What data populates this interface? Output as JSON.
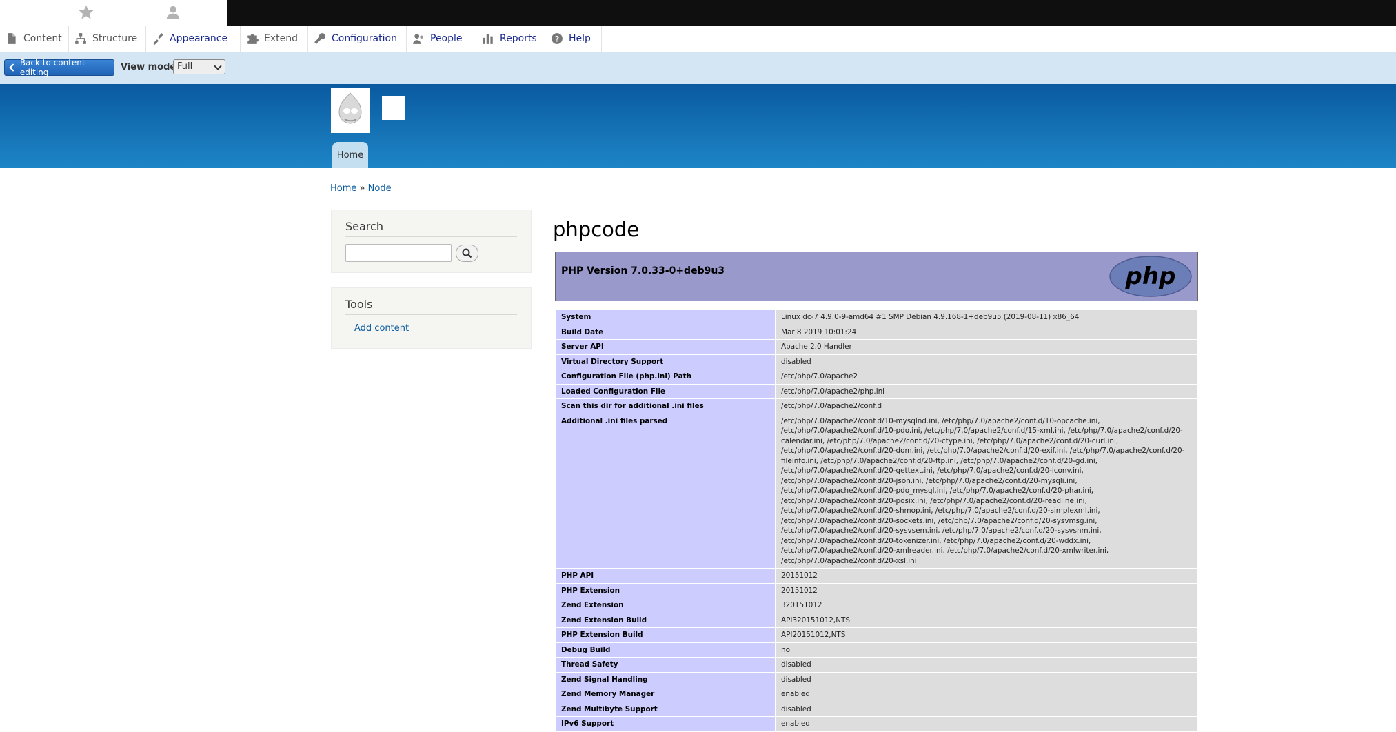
{
  "toolbar": {
    "icons": [
      "star-icon",
      "user-icon"
    ]
  },
  "admin_menu": {
    "items": [
      {
        "label": "Content",
        "icon": "file-icon"
      },
      {
        "label": "Structure",
        "icon": "sitemap-icon"
      },
      {
        "label": "Appearance",
        "icon": "paintbrush-icon"
      },
      {
        "label": "Extend",
        "icon": "puzzle-icon"
      },
      {
        "label": "Configuration",
        "icon": "wrench-icon"
      },
      {
        "label": "People",
        "icon": "people-icon"
      },
      {
        "label": "Reports",
        "icon": "bar-chart-icon"
      },
      {
        "label": "Help",
        "icon": "help-icon"
      }
    ]
  },
  "preview": {
    "back_label": "Back to content editing",
    "view_mode_label": "View mode:",
    "view_mode_value": "Full"
  },
  "header": {
    "nav_home": "Home"
  },
  "breadcrumb": {
    "home": "Home",
    "separator": "»",
    "node": "Node"
  },
  "sidebar": {
    "search_title": "Search",
    "tools_title": "Tools",
    "add_content": "Add content"
  },
  "main": {
    "title": "phpcode",
    "php_version": "PHP Version 7.0.33-0+deb9u3",
    "rows": [
      {
        "key": "System",
        "value": "Linux dc-7 4.9.0-9-amd64 #1 SMP Debian 4.9.168-1+deb9u5 (2019-08-11) x86_64"
      },
      {
        "key": "Build Date",
        "value": "Mar 8 2019 10:01:24"
      },
      {
        "key": "Server API",
        "value": "Apache 2.0 Handler"
      },
      {
        "key": "Virtual Directory Support",
        "value": "disabled"
      },
      {
        "key": "Configuration File (php.ini) Path",
        "value": "/etc/php/7.0/apache2"
      },
      {
        "key": "Loaded Configuration File",
        "value": "/etc/php/7.0/apache2/php.ini"
      },
      {
        "key": "Scan this dir for additional .ini files",
        "value": "/etc/php/7.0/apache2/conf.d"
      },
      {
        "key": "Additional .ini files parsed",
        "value": "/etc/php/7.0/apache2/conf.d/10-mysqlnd.ini, /etc/php/7.0/apache2/conf.d/10-opcache.ini, /etc/php/7.0/apache2/conf.d/10-pdo.ini, /etc/php/7.0/apache2/conf.d/15-xml.ini, /etc/php/7.0/apache2/conf.d/20-calendar.ini, /etc/php/7.0/apache2/conf.d/20-ctype.ini, /etc/php/7.0/apache2/conf.d/20-curl.ini, /etc/php/7.0/apache2/conf.d/20-dom.ini, /etc/php/7.0/apache2/conf.d/20-exif.ini, /etc/php/7.0/apache2/conf.d/20-fileinfo.ini, /etc/php/7.0/apache2/conf.d/20-ftp.ini, /etc/php/7.0/apache2/conf.d/20-gd.ini, /etc/php/7.0/apache2/conf.d/20-gettext.ini, /etc/php/7.0/apache2/conf.d/20-iconv.ini, /etc/php/7.0/apache2/conf.d/20-json.ini, /etc/php/7.0/apache2/conf.d/20-mysqli.ini, /etc/php/7.0/apache2/conf.d/20-pdo_mysql.ini, /etc/php/7.0/apache2/conf.d/20-phar.ini, /etc/php/7.0/apache2/conf.d/20-posix.ini, /etc/php/7.0/apache2/conf.d/20-readline.ini, /etc/php/7.0/apache2/conf.d/20-shmop.ini, /etc/php/7.0/apache2/conf.d/20-simplexml.ini, /etc/php/7.0/apache2/conf.d/20-sockets.ini, /etc/php/7.0/apache2/conf.d/20-sysvmsg.ini, /etc/php/7.0/apache2/conf.d/20-sysvsem.ini, /etc/php/7.0/apache2/conf.d/20-sysvshm.ini, /etc/php/7.0/apache2/conf.d/20-tokenizer.ini, /etc/php/7.0/apache2/conf.d/20-wddx.ini, /etc/php/7.0/apache2/conf.d/20-xmlreader.ini, /etc/php/7.0/apache2/conf.d/20-xmlwriter.ini, /etc/php/7.0/apache2/conf.d/20-xsl.ini"
      },
      {
        "key": "PHP API",
        "value": "20151012"
      },
      {
        "key": "PHP Extension",
        "value": "20151012"
      },
      {
        "key": "Zend Extension",
        "value": "320151012"
      },
      {
        "key": "Zend Extension Build",
        "value": "API320151012,NTS"
      },
      {
        "key": "PHP Extension Build",
        "value": "API20151012,NTS"
      },
      {
        "key": "Debug Build",
        "value": "no"
      },
      {
        "key": "Thread Safety",
        "value": "disabled"
      },
      {
        "key": "Zend Signal Handling",
        "value": "disabled"
      },
      {
        "key": "Zend Memory Manager",
        "value": "enabled"
      },
      {
        "key": "Zend Multibyte Support",
        "value": "disabled"
      },
      {
        "key": "IPv6 Support",
        "value": "enabled"
      }
    ]
  }
}
